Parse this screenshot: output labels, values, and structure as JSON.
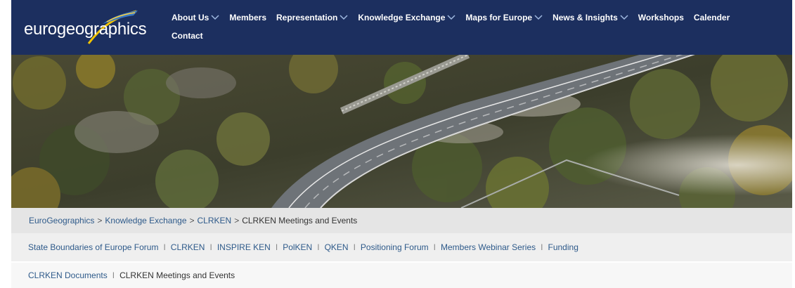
{
  "header": {
    "logo_text": "eurogeographics",
    "nav_row1": [
      {
        "label": "About Us",
        "dropdown": true
      },
      {
        "label": "Members",
        "dropdown": false
      },
      {
        "label": "Representation",
        "dropdown": true
      },
      {
        "label": "Knowledge Exchange",
        "dropdown": true
      },
      {
        "label": "Maps for Europe",
        "dropdown": true
      },
      {
        "label": "News & Insights",
        "dropdown": true
      },
      {
        "label": "Workshops",
        "dropdown": false
      },
      {
        "label": "Calender",
        "dropdown": false
      }
    ],
    "nav_row2": [
      {
        "label": "Contact",
        "dropdown": false
      }
    ]
  },
  "breadcrumb": {
    "items": [
      "EuroGeographics",
      "Knowledge Exchange",
      "CLRKEN",
      "CLRKEN Meetings and Events"
    ],
    "separator": ">"
  },
  "subnav": {
    "items": [
      "State Boundaries of Europe Forum",
      "CLRKEN",
      "INSPIRE KEN",
      "PolKEN",
      "QKEN",
      "Positioning Forum",
      "Members Webinar Series",
      "Funding"
    ],
    "separator": "I"
  },
  "subnav2": {
    "items": [
      "CLRKEN Documents",
      "CLRKEN Meetings and Events"
    ],
    "separator": "I"
  },
  "colors": {
    "header_bg": "#1c2f5f",
    "link": "#2e5a8a",
    "breadcrumb_bg": "#e5e5e5",
    "logo_swoosh_yellow": "#f2c400",
    "logo_swoosh_blue": "#3a78c3"
  }
}
